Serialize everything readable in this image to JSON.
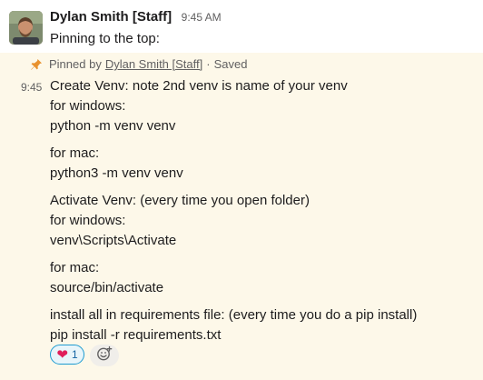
{
  "message1": {
    "sender": "Dylan Smith [Staff]",
    "time": "9:45 AM",
    "text": "Pinning to the top:"
  },
  "pinned": {
    "pinned_by_prefix": "Pinned by",
    "pinned_by_name": "Dylan Smith [Staff]",
    "separator": "·",
    "saved_label": "Saved",
    "time": "9:45",
    "lines": {
      "l1": "Create Venv: note 2nd venv is name of your venv",
      "l2": "for windows:",
      "l3": "python -m venv venv",
      "l4": "for mac:",
      "l5": "python3 -m venv venv",
      "l6": "Activate Venv: (every time you open folder)",
      "l7": "for windows:",
      "l8": "venv\\Scripts\\Activate",
      "l9": "for mac:",
      "l10": "source/bin/activate",
      "l11": "install all in requirements file: (every time you do a pip install)",
      "l12": "pip install -r requirements.txt"
    },
    "reaction": {
      "emoji": "❤",
      "count": "1"
    }
  },
  "colors": {
    "pinned_background": "#fdf8e9",
    "pin_icon": "#e8912d",
    "reaction_border": "#1d9bd1"
  },
  "icons": {
    "pin": "pin-icon",
    "add_reaction": "add-reaction-icon",
    "heart": "heart-emoji"
  }
}
